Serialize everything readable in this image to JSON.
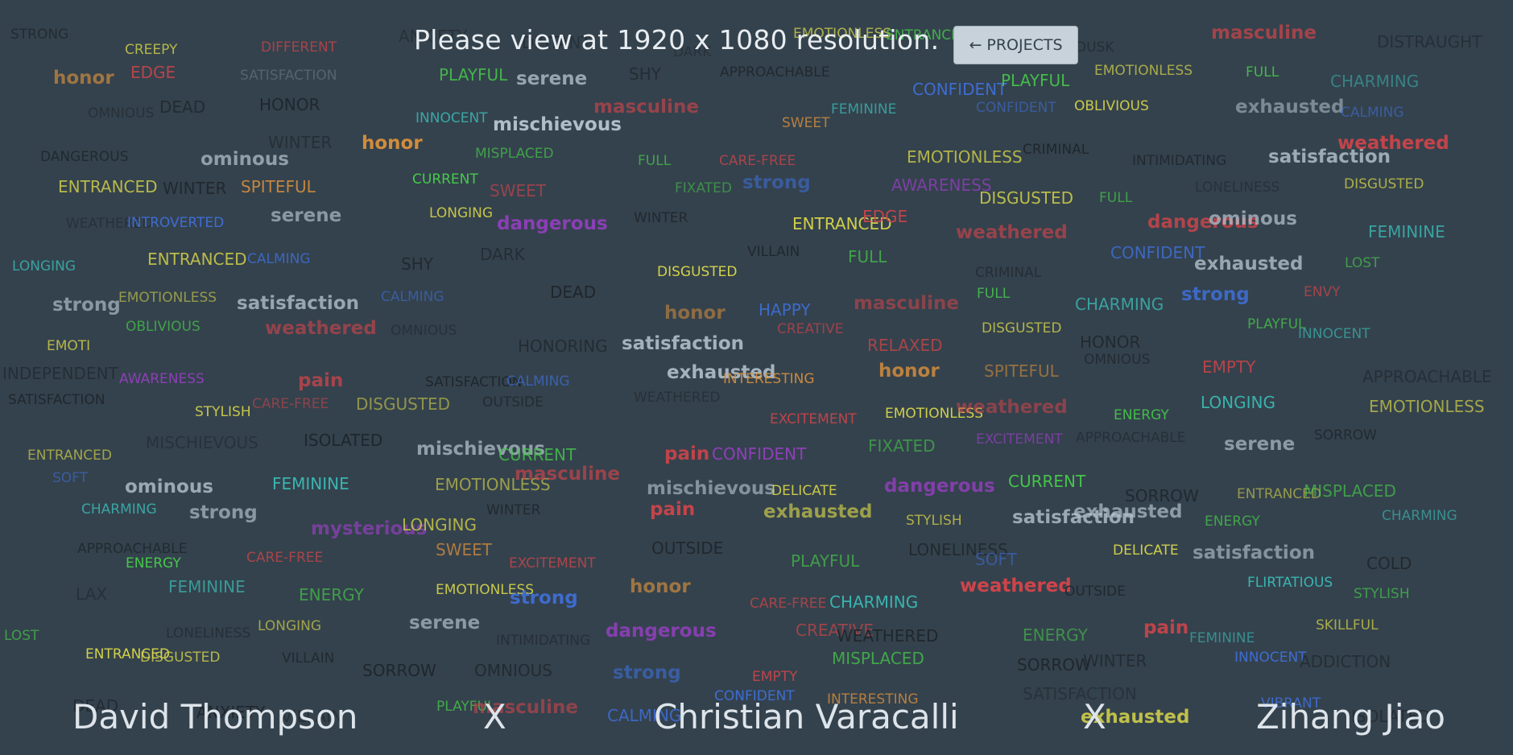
{
  "notice": "Please view at 1920 x 1080 resolution.",
  "projects_button": {
    "arrow": "←",
    "label": "PROJECTS"
  },
  "credits": [
    "David Thompson",
    "X",
    "Christian Varacalli",
    "X",
    "Zihang Jiao"
  ],
  "colors": {
    "background": "#34424d",
    "dark": "#1f262c",
    "grey": "#6c7a86",
    "yellow": "#d9d64a",
    "green": "#46c94a",
    "teal": "#3bb7b2",
    "blue": "#3f6fd8",
    "purple": "#a23fd0",
    "red": "#d0454a",
    "orange": "#d9903c",
    "light": "#b8c6d1"
  },
  "words": [
    {
      "t": "STRONG",
      "c": "dark"
    },
    {
      "t": "CREEPY",
      "c": "yellow"
    },
    {
      "t": "DIFFERENT",
      "c": "red"
    },
    {
      "t": "ANXIETY",
      "c": "dark"
    },
    {
      "t": "DISTANT",
      "c": "dark"
    },
    {
      "t": "DARK",
      "c": "dark"
    },
    {
      "t": "EMOTIONLESS",
      "c": "yellow"
    },
    {
      "t": "ENTRANCED",
      "c": "green"
    },
    {
      "t": "AWARENESS",
      "c": "purple"
    },
    {
      "t": "DUSK",
      "c": "dark"
    },
    {
      "t": "masculine",
      "c": "red"
    },
    {
      "t": "DISTRAUGHT",
      "c": "dark"
    },
    {
      "t": "honor",
      "c": "orange"
    },
    {
      "t": "EDGE",
      "c": "red"
    },
    {
      "t": "SATISFACTION",
      "c": "grey"
    },
    {
      "t": "PLAYFUL",
      "c": "green"
    },
    {
      "t": "serene",
      "c": "light"
    },
    {
      "t": "SHY",
      "c": "dark"
    },
    {
      "t": "APPROACHABLE",
      "c": "dark"
    },
    {
      "t": "CONFIDENT",
      "c": "blue"
    },
    {
      "t": "PLAYFUL",
      "c": "green"
    },
    {
      "t": "EMOTIONLESS",
      "c": "yellow"
    },
    {
      "t": "FULL",
      "c": "green"
    },
    {
      "t": "CHARMING",
      "c": "teal"
    },
    {
      "t": "OMNIOUS",
      "c": "dark"
    },
    {
      "t": "DEAD",
      "c": "dark"
    },
    {
      "t": "HONOR",
      "c": "dark"
    },
    {
      "t": "INNOCENT",
      "c": "teal"
    },
    {
      "t": "mischievous",
      "c": "light"
    },
    {
      "t": "masculine",
      "c": "red"
    },
    {
      "t": "SWEET",
      "c": "orange"
    },
    {
      "t": "FEMININE",
      "c": "teal"
    },
    {
      "t": "CONFIDENT",
      "c": "blue"
    },
    {
      "t": "OBLIVIOUS",
      "c": "yellow"
    },
    {
      "t": "exhausted",
      "c": "light"
    },
    {
      "t": "CALMING",
      "c": "blue"
    },
    {
      "t": "DANGEROUS",
      "c": "dark"
    },
    {
      "t": "ominous",
      "c": "light"
    },
    {
      "t": "WINTER",
      "c": "dark"
    },
    {
      "t": "honor",
      "c": "orange"
    },
    {
      "t": "MISPLACED",
      "c": "green"
    },
    {
      "t": "FULL",
      "c": "green"
    },
    {
      "t": "CARE-FREE",
      "c": "red"
    },
    {
      "t": "EMOTIONLESS",
      "c": "yellow"
    },
    {
      "t": "CRIMINAL",
      "c": "dark"
    },
    {
      "t": "INTIMIDATING",
      "c": "dark"
    },
    {
      "t": "satisfaction",
      "c": "light"
    },
    {
      "t": "weathered",
      "c": "red"
    },
    {
      "t": "ENTRANCED",
      "c": "yellow"
    },
    {
      "t": "WINTER",
      "c": "dark"
    },
    {
      "t": "SPITEFUL",
      "c": "orange"
    },
    {
      "t": "CURRENT",
      "c": "green"
    },
    {
      "t": "SWEET",
      "c": "red"
    },
    {
      "t": "FIXATED",
      "c": "green"
    },
    {
      "t": "strong",
      "c": "blue"
    },
    {
      "t": "AWARENESS",
      "c": "purple"
    },
    {
      "t": "DISGUSTED",
      "c": "yellow"
    },
    {
      "t": "FULL",
      "c": "green"
    },
    {
      "t": "LONELINESS",
      "c": "dark"
    },
    {
      "t": "DISGUSTED",
      "c": "yellow"
    },
    {
      "t": "WEATHERED",
      "c": "dark"
    },
    {
      "t": "INTROVERTED",
      "c": "blue"
    },
    {
      "t": "serene",
      "c": "light"
    },
    {
      "t": "LONGING",
      "c": "yellow"
    },
    {
      "t": "dangerous",
      "c": "purple"
    },
    {
      "t": "WINTER",
      "c": "dark"
    },
    {
      "t": "ENTRANCED",
      "c": "yellow"
    },
    {
      "t": "EDGE",
      "c": "red"
    },
    {
      "t": "weathered",
      "c": "red"
    },
    {
      "t": "dangerous",
      "c": "red"
    },
    {
      "t": "ominous",
      "c": "light"
    },
    {
      "t": "FEMININE",
      "c": "teal"
    },
    {
      "t": "LONGING",
      "c": "teal"
    },
    {
      "t": "ENTRANCED",
      "c": "yellow"
    },
    {
      "t": "CALMING",
      "c": "blue"
    },
    {
      "t": "SHY",
      "c": "dark"
    },
    {
      "t": "DARK",
      "c": "dark"
    },
    {
      "t": "DISGUSTED",
      "c": "yellow"
    },
    {
      "t": "VILLAIN",
      "c": "dark"
    },
    {
      "t": "FULL",
      "c": "green"
    },
    {
      "t": "CRIMINAL",
      "c": "dark"
    },
    {
      "t": "CONFIDENT",
      "c": "blue"
    },
    {
      "t": "exhausted",
      "c": "light"
    },
    {
      "t": "LOST",
      "c": "green"
    },
    {
      "t": "strong",
      "c": "light"
    },
    {
      "t": "EMOTIONLESS",
      "c": "yellow"
    },
    {
      "t": "satisfaction",
      "c": "light"
    },
    {
      "t": "CALMING",
      "c": "blue"
    },
    {
      "t": "DEAD",
      "c": "dark"
    },
    {
      "t": "honor",
      "c": "orange"
    },
    {
      "t": "HAPPY",
      "c": "blue"
    },
    {
      "t": "masculine",
      "c": "red"
    },
    {
      "t": "FULL",
      "c": "green"
    },
    {
      "t": "CHARMING",
      "c": "teal"
    },
    {
      "t": "strong",
      "c": "blue"
    },
    {
      "t": "ENVY",
      "c": "red"
    },
    {
      "t": "EMOTI",
      "c": "yellow"
    },
    {
      "t": "OBLIVIOUS",
      "c": "green"
    },
    {
      "t": "weathered",
      "c": "red"
    },
    {
      "t": "OMNIOUS",
      "c": "dark"
    },
    {
      "t": "HONORING",
      "c": "dark"
    },
    {
      "t": "satisfaction",
      "c": "light"
    },
    {
      "t": "CREATIVE",
      "c": "red"
    },
    {
      "t": "RELAXED",
      "c": "red"
    },
    {
      "t": "DISGUSTED",
      "c": "yellow"
    },
    {
      "t": "HONOR",
      "c": "dark"
    },
    {
      "t": "PLAYFUL",
      "c": "green"
    },
    {
      "t": "INNOCENT",
      "c": "teal"
    },
    {
      "t": "INDEPENDENT",
      "c": "dark"
    },
    {
      "t": "AWARENESS",
      "c": "purple"
    },
    {
      "t": "pain",
      "c": "red"
    },
    {
      "t": "SATISFACTION",
      "c": "dark"
    },
    {
      "t": "CALMING",
      "c": "blue"
    },
    {
      "t": "exhausted",
      "c": "light"
    },
    {
      "t": "INTERESTING",
      "c": "orange"
    },
    {
      "t": "honor",
      "c": "orange"
    },
    {
      "t": "SPITEFUL",
      "c": "orange"
    },
    {
      "t": "OMNIOUS",
      "c": "dark"
    },
    {
      "t": "EMPTY",
      "c": "red"
    },
    {
      "t": "APPROACHABLE",
      "c": "dark"
    },
    {
      "t": "SATISFACTION",
      "c": "dark"
    },
    {
      "t": "STYLISH",
      "c": "yellow"
    },
    {
      "t": "CARE-FREE",
      "c": "red"
    },
    {
      "t": "DISGUSTED",
      "c": "yellow"
    },
    {
      "t": "OUTSIDE",
      "c": "dark"
    },
    {
      "t": "WEATHERED",
      "c": "dark"
    },
    {
      "t": "EXCITEMENT",
      "c": "red"
    },
    {
      "t": "EMOTIONLESS",
      "c": "yellow"
    },
    {
      "t": "weathered",
      "c": "red"
    },
    {
      "t": "ENERGY",
      "c": "green"
    },
    {
      "t": "LONGING",
      "c": "teal"
    },
    {
      "t": "EMOTIONLESS",
      "c": "yellow"
    },
    {
      "t": "ENTRANCED",
      "c": "yellow"
    },
    {
      "t": "MISCHIEVOUS",
      "c": "dark"
    },
    {
      "t": "ISOLATED",
      "c": "dark"
    },
    {
      "t": "mischievous",
      "c": "light"
    },
    {
      "t": "CURRENT",
      "c": "green"
    },
    {
      "t": "pain",
      "c": "red"
    },
    {
      "t": "CONFIDENT",
      "c": "purple"
    },
    {
      "t": "FIXATED",
      "c": "green"
    },
    {
      "t": "EXCITEMENT",
      "c": "purple"
    },
    {
      "t": "APPROACHABLE",
      "c": "dark"
    },
    {
      "t": "serene",
      "c": "light"
    },
    {
      "t": "SORROW",
      "c": "dark"
    },
    {
      "t": "SOFT",
      "c": "blue"
    },
    {
      "t": "ominous",
      "c": "light"
    },
    {
      "t": "FEMININE",
      "c": "teal"
    },
    {
      "t": "EMOTIONLESS",
      "c": "yellow"
    },
    {
      "t": "masculine",
      "c": "red"
    },
    {
      "t": "mischievous",
      "c": "light"
    },
    {
      "t": "DELICATE",
      "c": "yellow"
    },
    {
      "t": "dangerous",
      "c": "purple"
    },
    {
      "t": "CURRENT",
      "c": "green"
    },
    {
      "t": "SORROW",
      "c": "dark"
    },
    {
      "t": "ENTRANCED",
      "c": "yellow"
    },
    {
      "t": "MISPLACED",
      "c": "green"
    },
    {
      "t": "CHARMING",
      "c": "teal"
    },
    {
      "t": "strong",
      "c": "light"
    },
    {
      "t": "mysterious",
      "c": "purple"
    },
    {
      "t": "LONGING",
      "c": "yellow"
    },
    {
      "t": "WINTER",
      "c": "dark"
    },
    {
      "t": "pain",
      "c": "red"
    },
    {
      "t": "exhausted",
      "c": "yellow"
    },
    {
      "t": "STYLISH",
      "c": "yellow"
    },
    {
      "t": "satisfaction",
      "c": "light"
    },
    {
      "t": "exhausted",
      "c": "light"
    },
    {
      "t": "ENERGY",
      "c": "green"
    },
    {
      "t": "CHARMING",
      "c": "teal"
    },
    {
      "t": "APPROACHABLE",
      "c": "dark"
    },
    {
      "t": "ENERGY",
      "c": "green"
    },
    {
      "t": "CARE-FREE",
      "c": "red"
    },
    {
      "t": "SWEET",
      "c": "orange"
    },
    {
      "t": "EXCITEMENT",
      "c": "red"
    },
    {
      "t": "OUTSIDE",
      "c": "dark"
    },
    {
      "t": "PLAYFUL",
      "c": "green"
    },
    {
      "t": "LONELINESS",
      "c": "dark"
    },
    {
      "t": "SOFT",
      "c": "blue"
    },
    {
      "t": "DELICATE",
      "c": "yellow"
    },
    {
      "t": "satisfaction",
      "c": "light"
    },
    {
      "t": "COLD",
      "c": "dark"
    },
    {
      "t": "LAX",
      "c": "dark"
    },
    {
      "t": "FEMININE",
      "c": "teal"
    },
    {
      "t": "ENERGY",
      "c": "green"
    },
    {
      "t": "EMOTIONLESS",
      "c": "yellow"
    },
    {
      "t": "strong",
      "c": "blue"
    },
    {
      "t": "honor",
      "c": "orange"
    },
    {
      "t": "CARE-FREE",
      "c": "red"
    },
    {
      "t": "CHARMING",
      "c": "teal"
    },
    {
      "t": "weathered",
      "c": "red"
    },
    {
      "t": "OUTSIDE",
      "c": "dark"
    },
    {
      "t": "FLIRTATIOUS",
      "c": "teal"
    },
    {
      "t": "STYLISH",
      "c": "green"
    },
    {
      "t": "LOST",
      "c": "green"
    },
    {
      "t": "LONELINESS",
      "c": "dark"
    },
    {
      "t": "LONGING",
      "c": "yellow"
    },
    {
      "t": "serene",
      "c": "light"
    },
    {
      "t": "INTIMIDATING",
      "c": "dark"
    },
    {
      "t": "dangerous",
      "c": "purple"
    },
    {
      "t": "CREATIVE",
      "c": "red"
    },
    {
      "t": "WEATHERED",
      "c": "dark"
    },
    {
      "t": "ENERGY",
      "c": "green"
    },
    {
      "t": "pain",
      "c": "red"
    },
    {
      "t": "FEMININE",
      "c": "teal"
    },
    {
      "t": "SKILLFUL",
      "c": "yellow"
    },
    {
      "t": "ENTRANCED",
      "c": "yellow"
    },
    {
      "t": "DISGUSTED",
      "c": "yellow"
    },
    {
      "t": "VILLAIN",
      "c": "dark"
    },
    {
      "t": "SORROW",
      "c": "dark"
    },
    {
      "t": "OMNIOUS",
      "c": "dark"
    },
    {
      "t": "strong",
      "c": "blue"
    },
    {
      "t": "EMPTY",
      "c": "red"
    },
    {
      "t": "MISPLACED",
      "c": "green"
    },
    {
      "t": "SORROW",
      "c": "dark"
    },
    {
      "t": "WINTER",
      "c": "dark"
    },
    {
      "t": "INNOCENT",
      "c": "blue"
    },
    {
      "t": "ADDICTION",
      "c": "dark"
    },
    {
      "t": "DEAD",
      "c": "dark"
    },
    {
      "t": "ANXIETY",
      "c": "dark"
    },
    {
      "t": "VILLAIN",
      "c": "dark"
    },
    {
      "t": "PLAYFUL",
      "c": "green"
    },
    {
      "t": "masculine",
      "c": "red"
    },
    {
      "t": "CALMING",
      "c": "blue"
    },
    {
      "t": "CONFIDENT",
      "c": "blue"
    },
    {
      "t": "INTERESTING",
      "c": "orange"
    },
    {
      "t": "SATISFACTION",
      "c": "dark"
    },
    {
      "t": "exhausted",
      "c": "yellow"
    },
    {
      "t": "VIBRANT",
      "c": "blue"
    },
    {
      "t": "ISOLATED",
      "c": "dark"
    }
  ]
}
